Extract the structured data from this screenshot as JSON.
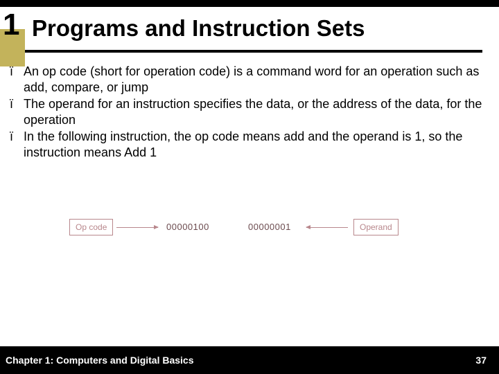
{
  "chapter_number": "1",
  "title": "Programs and Instruction Sets",
  "bullets": [
    "An op code (short for operation code) is a command word for an operation such as add, compare, or jump",
    "The operand for an instruction specifies the data, or the address of the data, for the operation",
    "In the following instruction, the op code means add and the operand is 1, so the instruction means Add 1"
  ],
  "bullet_marker": "ï",
  "diagram": {
    "left_label": "Op code",
    "value1": "00000100",
    "value2": "00000001",
    "right_label": "Operand"
  },
  "footer": {
    "left": "Chapter 1: Computers and Digital Basics",
    "right": "37"
  }
}
